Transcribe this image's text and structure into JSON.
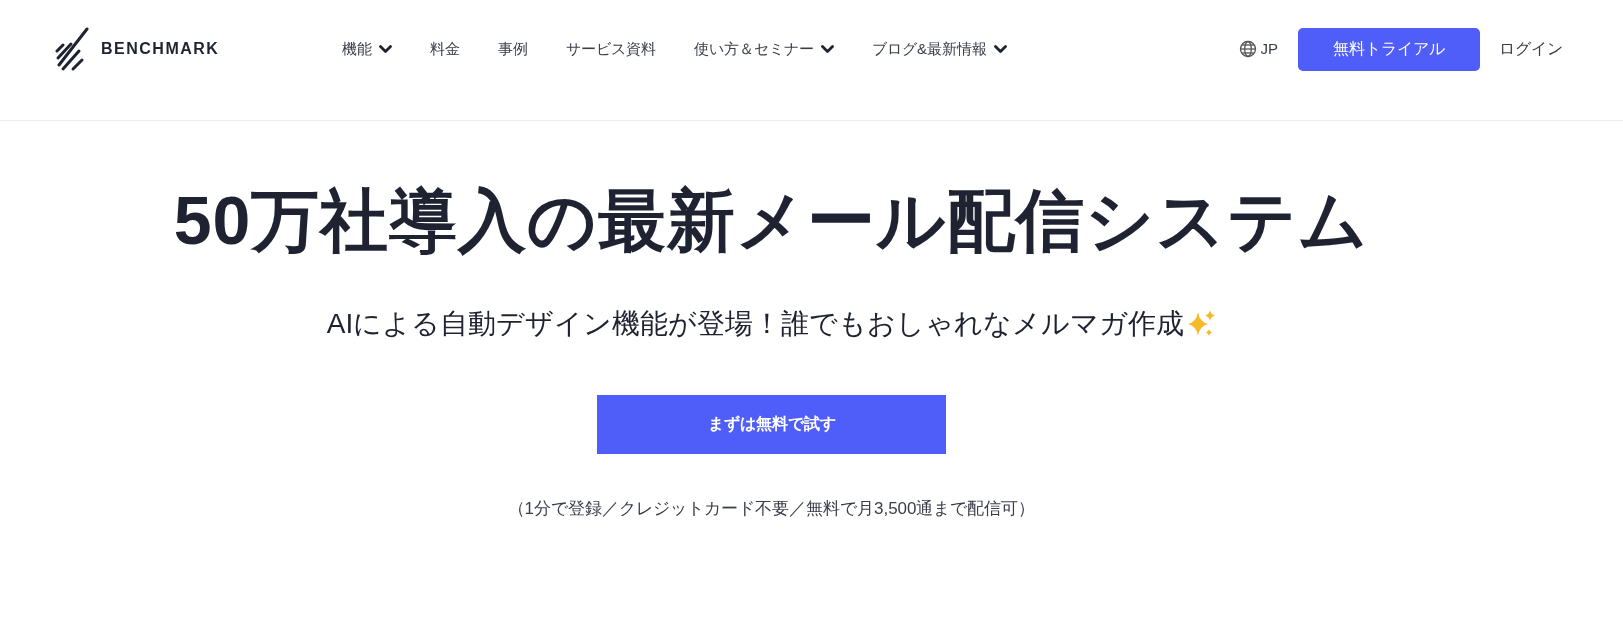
{
  "header": {
    "logo_text": "BENCHMARK",
    "nav": [
      {
        "label": "機能",
        "has_dropdown": true
      },
      {
        "label": "料金",
        "has_dropdown": false
      },
      {
        "label": "事例",
        "has_dropdown": false
      },
      {
        "label": "サービス資料",
        "has_dropdown": false
      },
      {
        "label": "使い方＆セミナー",
        "has_dropdown": true
      },
      {
        "label": "ブログ&最新情報",
        "has_dropdown": true
      }
    ],
    "language": "JP",
    "trial_button": "無料トライアル",
    "login": "ログイン"
  },
  "hero": {
    "headline": "50万社導入の最新メール配信システム",
    "subtitle": "AIによる自動デザイン機能が登場！誰でもおしゃれなメルマガ作成",
    "cta_button": "まずは無料で試す",
    "note": "（1分で登録／クレジットカード不要／無料で月3,500通まで配信可）"
  }
}
